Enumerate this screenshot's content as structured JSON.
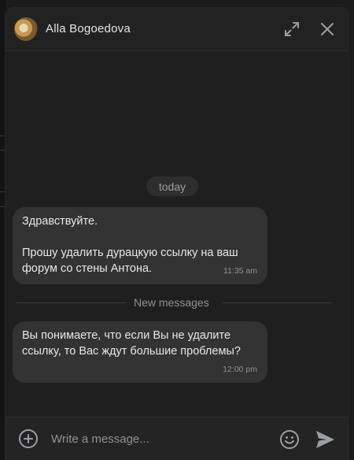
{
  "header": {
    "contact_name": "Alla Bogoedova",
    "icons": {
      "expand": "expand-icon",
      "close": "close-icon"
    }
  },
  "messages": {
    "date_label": "today",
    "divider_label": "New messages",
    "items": [
      {
        "text": "Здравствуйте.\n\nПрошу удалить дурацкую ссылку на ваш форум со стены Антона.",
        "time": "11:35 am"
      },
      {
        "text": "Вы понимаете, что если Вы не удалите ссылку, то Вас ждут большие проблемы?",
        "time": "12:00 pm"
      }
    ]
  },
  "composer": {
    "placeholder": "Write a message...",
    "value": "",
    "icons": {
      "attach": "plus-circle-icon",
      "emoji": "smile-icon",
      "send": "send-icon"
    }
  },
  "colors": {
    "window_bg": "#1f1f1f",
    "bubble_bg": "#333333",
    "text": "#e1e3e6",
    "secondary_text": "#8e9296"
  }
}
